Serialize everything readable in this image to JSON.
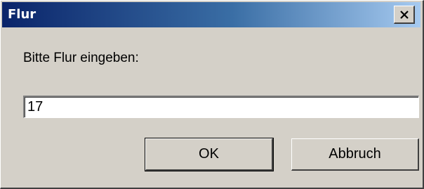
{
  "window": {
    "title": "Flur"
  },
  "dialog": {
    "prompt": "Bitte Flur eingeben:",
    "input_value": "17",
    "ok_label": "OK",
    "cancel_label": "Abbruch"
  },
  "icons": {
    "close": "close-icon"
  },
  "colors": {
    "titlebar_start": "#0a246a",
    "titlebar_end": "#a6caf0",
    "face": "#d4d0c8"
  }
}
